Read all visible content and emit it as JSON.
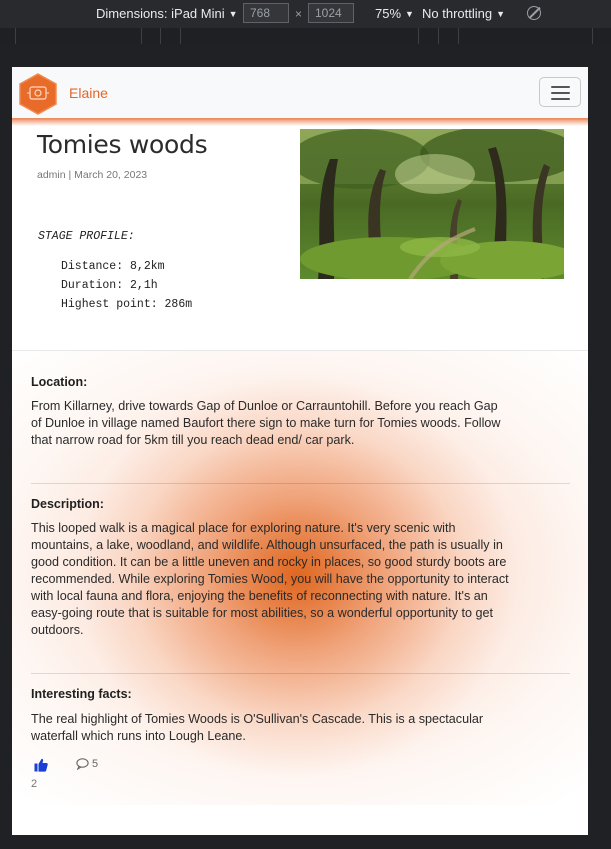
{
  "devtools": {
    "dimensions_label": "Dimensions: iPad Mini",
    "width": "768",
    "height": "1024",
    "zoom": "75%",
    "throttling": "No throttling"
  },
  "navbar": {
    "brand": "Elaine"
  },
  "post": {
    "title": "Tomies woods",
    "meta": "admin | March 20, 2023",
    "stage_heading": "STAGE PROFILE:",
    "distance": "Distance: 8,2km",
    "duration": "Duration: 2,1h",
    "highest_point": "Highest point: 286m"
  },
  "sections": {
    "location": {
      "heading": "Location:",
      "lines": [
        "From Killarney, drive towards Gap of Dunloe or Carrauntohill. Before you reach Gap",
        "of Dunloe in village named Baufort there sign to make turn for Tomies woods. Follow",
        "that narrow road for 5km till you reach dead end/ car park."
      ]
    },
    "description": {
      "heading": "Description:",
      "lines": [
        "This looped walk is a magical place for exploring nature. It's very scenic with",
        "mountains, a lake, woodland, and wildlife. Although unsurfaced, the path is usually in",
        "good condition. It can be a little uneven and rocky in places, so good sturdy boots are",
        "recommended. While exploring Tomies Wood, you will have the opportunity to interact",
        "with local fauna and flora, enjoying the benefits of reconnecting with nature. It's an",
        "easy-going route that is suitable for most abilities, so a wonderful opportunity to get",
        "outdoors."
      ]
    },
    "facts": {
      "heading": "Interesting facts:",
      "lines": [
        "The real highlight of Tomies Woods is O'Sullivan's Cascade. This is a spectacular",
        "waterfall which runs into Lough Leane."
      ]
    }
  },
  "engagement": {
    "comment_count": "5",
    "like_count": "2"
  },
  "icons": {
    "like": "thumbs-up-icon",
    "comment": "comment-icon",
    "menu": "hamburger-icon",
    "rotate": "rotate-icon"
  },
  "colors": {
    "brand": "#e2672a",
    "like_icon": "#1a3fd6"
  }
}
